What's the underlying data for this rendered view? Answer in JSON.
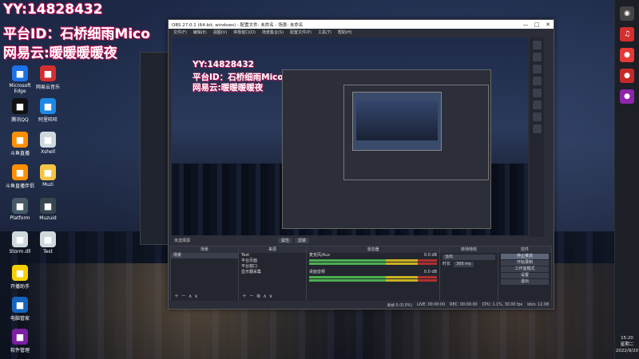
{
  "overlay": {
    "line1": "YY:14828432",
    "line2": "平台ID：石桥细雨Mico",
    "line3": "网易云:暖暖暖暖夜"
  },
  "desktop_icons": [
    {
      "label": "Microsoft Edge",
      "color": "#1a73e8"
    },
    {
      "label": "网易云音乐",
      "color": "#d32f2f"
    },
    {
      "label": "腾讯QQ",
      "color": "#111111"
    },
    {
      "label": "阿里旺旺",
      "color": "#1e88e5"
    },
    {
      "label": "斗鱼直播",
      "color": "#ff8f00"
    },
    {
      "label": "Xshell",
      "color": "#cfd8dc"
    },
    {
      "label": "斗鱼直播伴侣",
      "color": "#ff8f00"
    },
    {
      "label": "Muzi",
      "color": "#f5c542"
    },
    {
      "label": "Platform",
      "color": "#455a64"
    },
    {
      "label": "Muzuid",
      "color": "#37474f"
    },
    {
      "label": "Storm.dll",
      "color": "#cfd8dc"
    },
    {
      "label": "Test",
      "color": "#cfd8dc"
    },
    {
      "label": "开播助手",
      "color": "#f5d000"
    },
    {
      "label": "电脑管家",
      "color": "#1565c0"
    },
    {
      "label": "软件管理",
      "color": "#7b1fa2"
    }
  ],
  "obs": {
    "title": "OBS 27.0.1 (64-bit, windows) - 配置文件: 未命名 - 场景: 未命名",
    "menu": [
      "文件(F)",
      "编辑(E)",
      "视图(V)",
      "停靠窗口(D)",
      "场景集合(S)",
      "配置文件(P)",
      "工具(T)",
      "帮助(H)"
    ],
    "window_buttons": [
      "—",
      "□",
      "✕"
    ],
    "no_source": "未选择源",
    "props_button": "属性",
    "filters_button": "滤镜",
    "docks": {
      "scenes": {
        "title": "场景",
        "items": [
          "场景"
        ]
      },
      "sources": {
        "title": "来源",
        "items": [
          "Text",
          "平台页面",
          "平台窗口",
          "显示器采集"
        ]
      },
      "mixer": {
        "title": "混音器",
        "channels": [
          {
            "name": "麦克风/Aux",
            "level": "0.0 dB"
          },
          {
            "name": "桌面音频",
            "level": "0.0 dB"
          }
        ]
      },
      "transitions": {
        "title": "转场特效",
        "type": "淡出",
        "duration_label": "时长",
        "duration": "300 ms"
      },
      "controls": {
        "title": "控件",
        "buttons": [
          "停止推流",
          "开始录制",
          "工作室模式",
          "设置",
          "退出"
        ]
      }
    },
    "status": {
      "drop": "丢帧 0 (0.0%)",
      "live": "LIVE: 00:00:00",
      "rec": "REC: 00:00:00",
      "cpu": "CPU: 1.1%, 30.00 fps",
      "kbps": "kb/s: 12.08"
    }
  },
  "tray": {
    "time": "15:20",
    "weekday": "星期二",
    "date": "2022/9/20"
  },
  "colors": {
    "overlay_glow": "#c2185b",
    "obs_bg": "#2b2e38",
    "active_button": "#5c6578"
  }
}
